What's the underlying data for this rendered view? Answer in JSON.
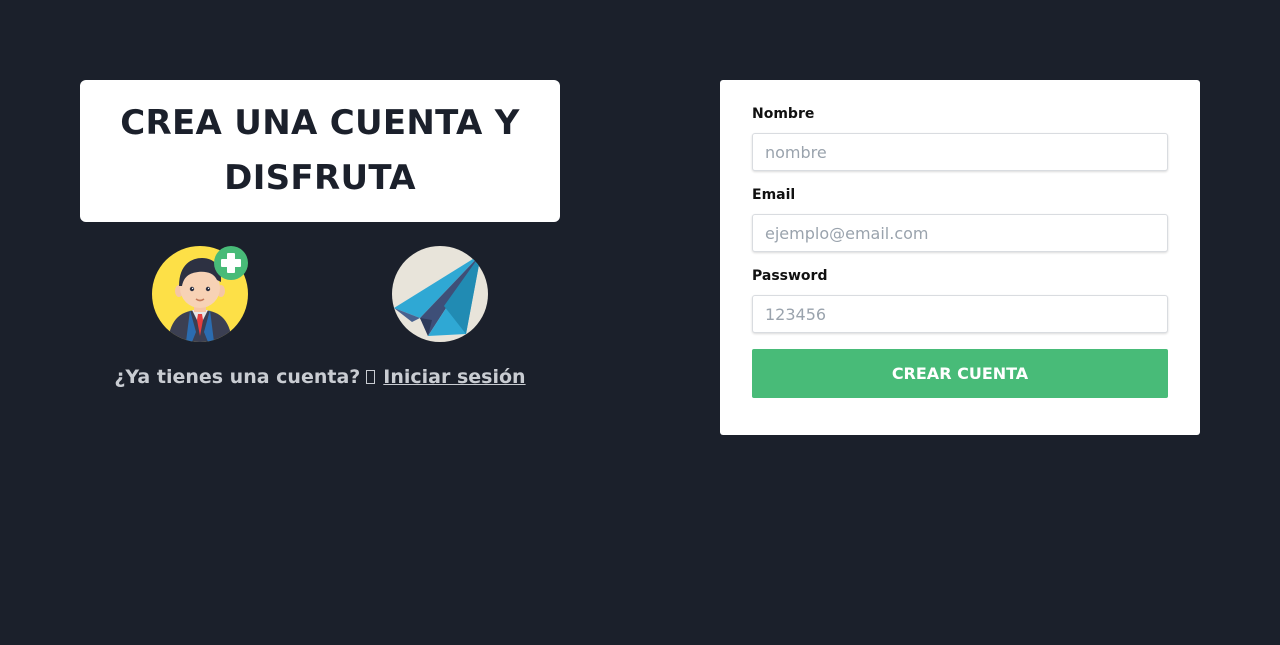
{
  "hero": {
    "title": "CREA UNA CUENTA Y DISFRUTA"
  },
  "illustrations": {
    "user": "add-user-icon",
    "plane": "paper-plane-icon"
  },
  "login_prompt": {
    "text": "¿Ya tienes una cuenta?",
    "link_label": "Iniciar sesión"
  },
  "form": {
    "name_label": "Nombre",
    "name_placeholder": "nombre",
    "email_label": "Email",
    "email_placeholder": "ejemplo@email.com",
    "password_label": "Password",
    "password_placeholder": "123456",
    "submit_label": "CREAR CUENTA"
  },
  "colors": {
    "background": "#1b202b",
    "accent": "#48bb78"
  }
}
